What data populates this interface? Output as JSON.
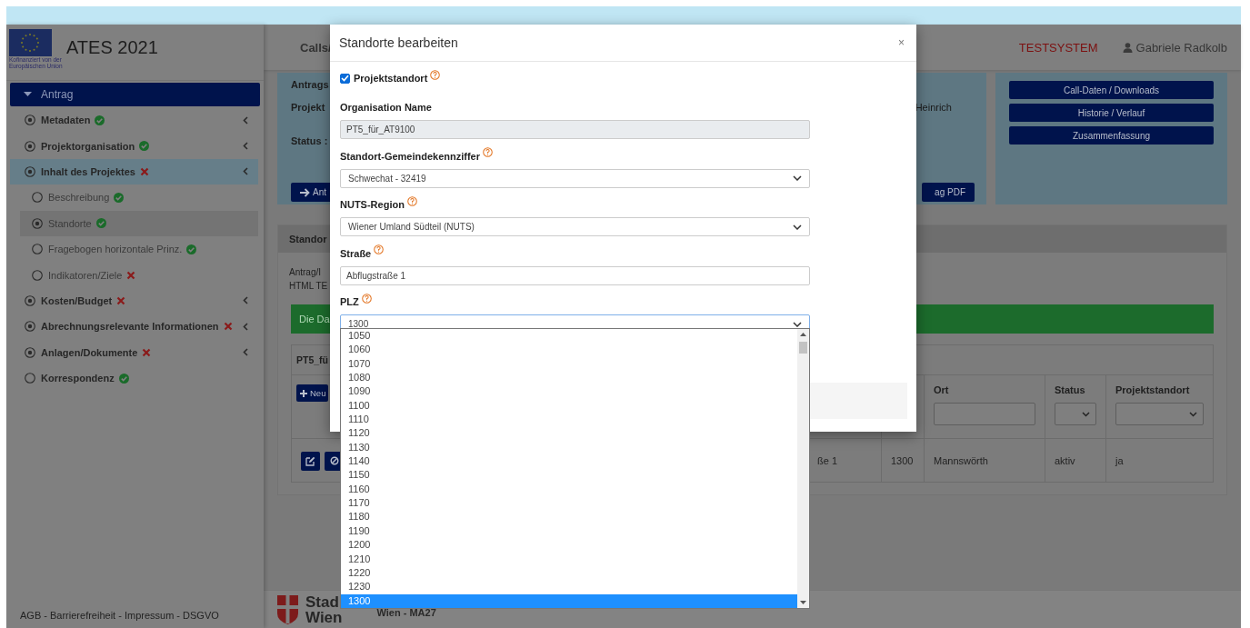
{
  "sidebar": {
    "logo_caption": [
      "Kofinanziert von der",
      "Europäischen Union"
    ],
    "app_title": "ATES 2021",
    "section": {
      "label": "Antrag",
      "expanded": true
    },
    "items": [
      {
        "label": "Metadaten",
        "valid": true,
        "marked": true,
        "collapsible": true,
        "expanded": false
      },
      {
        "label": "Projektorganisation",
        "valid": true,
        "marked": true,
        "collapsible": true,
        "expanded": false
      },
      {
        "label": "Inhalt des Projektes",
        "valid": false,
        "marked": true,
        "collapsible": true,
        "expanded": true,
        "children": [
          {
            "label": "Beschreibung",
            "valid": true,
            "marked": false,
            "selected": false
          },
          {
            "label": "Standorte",
            "valid": true,
            "marked": true,
            "selected": true
          },
          {
            "label": "Fragebogen horizontale Prinz.",
            "valid": true,
            "marked": false,
            "selected": false
          },
          {
            "label": "Indikatoren/Ziele",
            "valid": false,
            "marked": false,
            "selected": false
          }
        ]
      },
      {
        "label": "Kosten/Budget",
        "valid": false,
        "marked": true,
        "collapsible": true,
        "expanded": false
      },
      {
        "label": "Abrechnungsrelevante Informationen",
        "valid": false,
        "marked": true,
        "collapsible": true,
        "expanded": false
      },
      {
        "label": "Anlagen/Dokumente",
        "valid": false,
        "marked": true,
        "collapsible": true,
        "expanded": false
      },
      {
        "label": "Korrespondenz",
        "valid": true,
        "marked": false,
        "collapsible": false,
        "expanded": false
      }
    ],
    "footer": "AGB - Barrierefreiheit - Impressum - DSGVO"
  },
  "topbar": {
    "nav_text": "Calls/",
    "environment": "TESTSYSTEM",
    "user": "Gabriele Radkolb"
  },
  "summary_card": {
    "labels": [
      "Antrags",
      "Projekt",
      "Status :"
    ],
    "value": "Heinrich",
    "buttons": [
      "Ant",
      "ag PDF"
    ]
  },
  "actions": [
    "Call-Daten / Downloads",
    "Historie / Verlauf",
    "Zusammenfassung"
  ],
  "locations_panel": {
    "title": "Standor",
    "intro": [
      "Antrag/I",
      "HTML TE"
    ],
    "alert": "Die Da",
    "table_panel": {
      "title": "PT5_fü",
      "new_button": "Neu",
      "columns": [
        {
          "kind": "blank"
        },
        {
          "kind": "blank"
        },
        {
          "label": "Ort",
          "kind": "text"
        },
        {
          "label": "Status",
          "kind": "select"
        },
        {
          "label": "Projektstandort",
          "kind": "select"
        }
      ],
      "rows": [
        {
          "cells": [
            "ße 1",
            "1300",
            "Mannswörth",
            "aktiv",
            "ja"
          ]
        }
      ]
    }
  },
  "footer": {
    "logo_text": [
      "Stad",
      "Wien"
    ],
    "department": "Wien - MA27"
  },
  "modal": {
    "title": "Standorte bearbeiten",
    "close": "×",
    "checkbox": {
      "label": "Projektstandort",
      "checked": true,
      "help": true
    },
    "fields": [
      {
        "label": "Organisation Name",
        "kind": "readonly",
        "value": "PT5_für_AT9100",
        "help": false,
        "focused": false
      },
      {
        "label": "Standort-Gemeindekennziffer",
        "kind": "select",
        "value": "Schwechat - 32419",
        "help": true,
        "focused": false
      },
      {
        "label": "NUTS-Region",
        "kind": "select",
        "value": "Wiener Umland Südteil (NUTS)",
        "help": true,
        "focused": false
      },
      {
        "label": "Straße",
        "kind": "text",
        "value": "Abflugstraße 1",
        "help": true,
        "focused": false
      },
      {
        "label": "PLZ",
        "kind": "select",
        "value": "1300",
        "help": true,
        "focused": true
      }
    ],
    "dropdown": {
      "options": [
        {
          "label": "1050",
          "selected": false
        },
        {
          "label": "1060",
          "selected": false
        },
        {
          "label": "1070",
          "selected": false
        },
        {
          "label": "1080",
          "selected": false
        },
        {
          "label": "1090",
          "selected": false
        },
        {
          "label": "1100",
          "selected": false
        },
        {
          "label": "1110",
          "selected": false
        },
        {
          "label": "1120",
          "selected": false
        },
        {
          "label": "1130",
          "selected": false
        },
        {
          "label": "1140",
          "selected": false
        },
        {
          "label": "1150",
          "selected": false
        },
        {
          "label": "1160",
          "selected": false
        },
        {
          "label": "1170",
          "selected": false
        },
        {
          "label": "1180",
          "selected": false
        },
        {
          "label": "1190",
          "selected": false
        },
        {
          "label": "1200",
          "selected": false
        },
        {
          "label": "1210",
          "selected": false
        },
        {
          "label": "1220",
          "selected": false
        },
        {
          "label": "1230",
          "selected": false
        },
        {
          "label": "1300",
          "selected": true
        }
      ]
    }
  }
}
